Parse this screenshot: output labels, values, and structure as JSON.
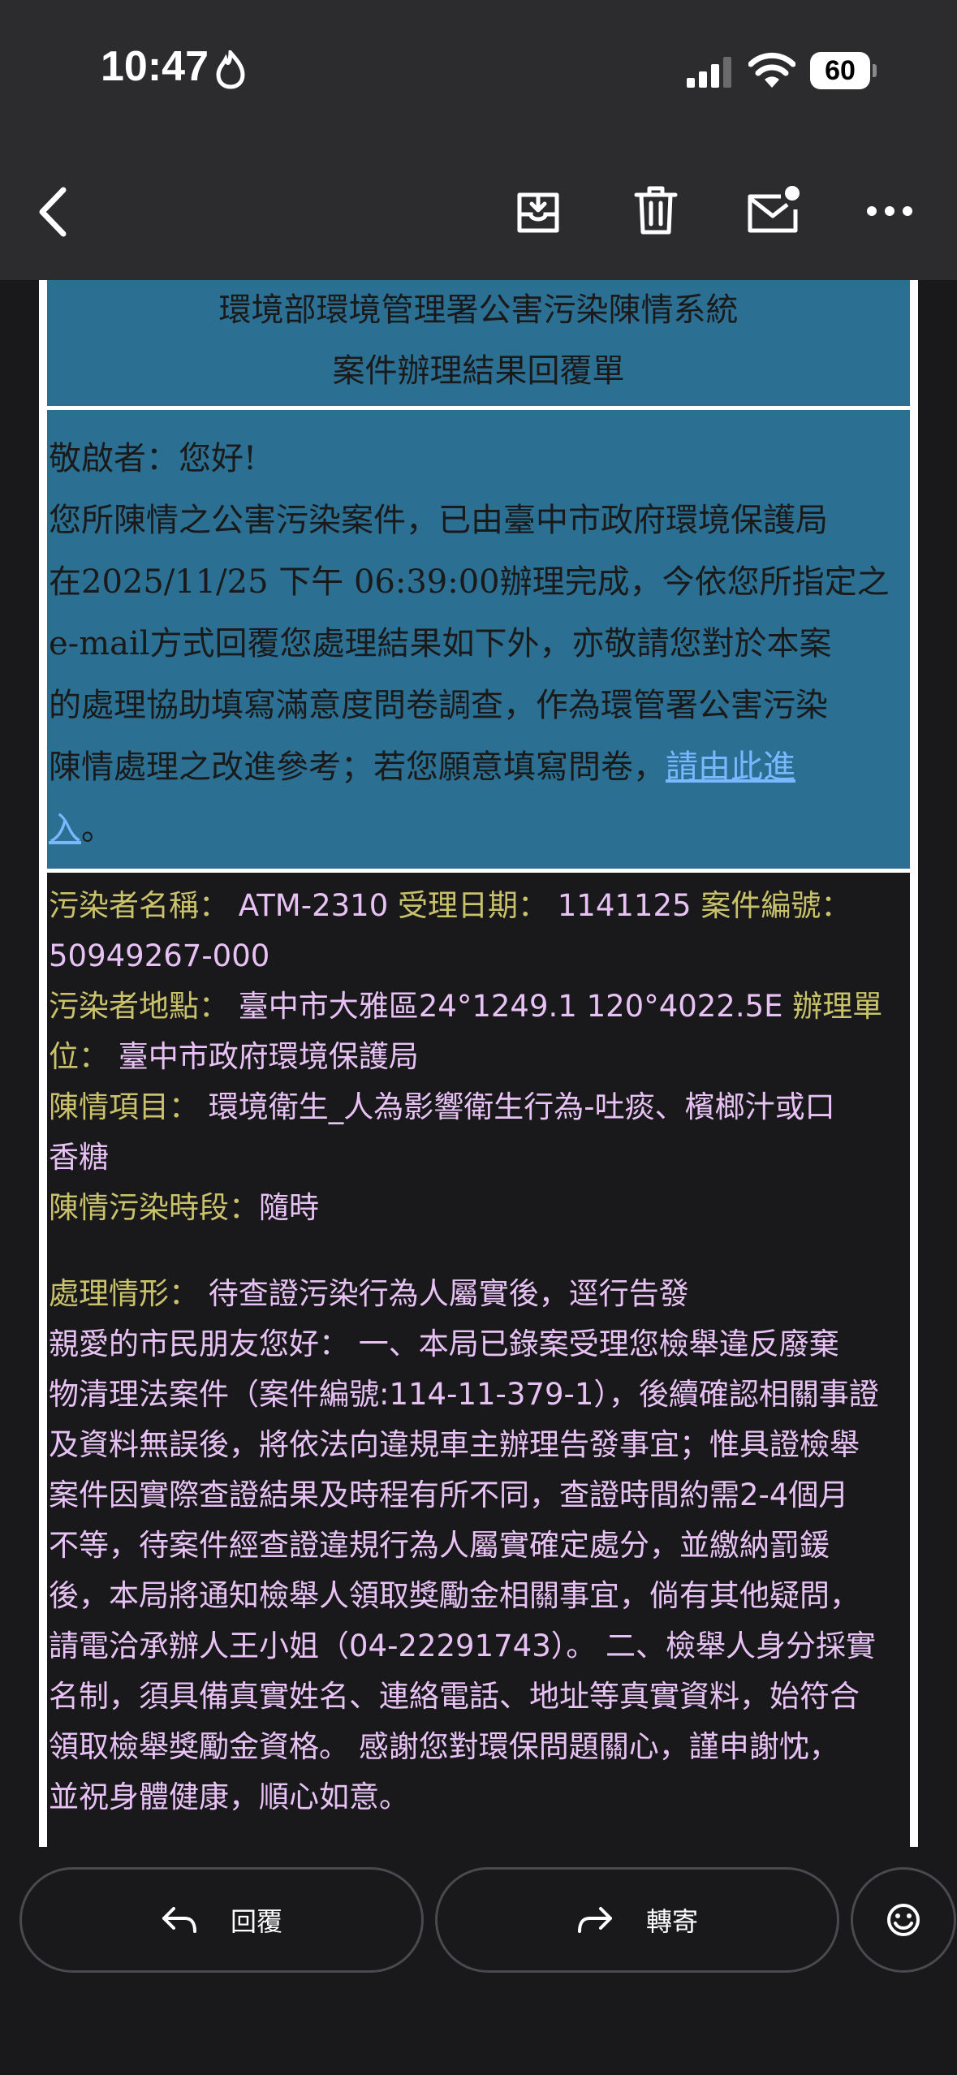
{
  "status_bar": {
    "time": "10:47",
    "battery_level": "60"
  },
  "toolbar": {
    "icons": [
      "back-chevron-icon",
      "archive-icon",
      "trash-icon",
      "mark-unread-icon",
      "more-icon"
    ]
  },
  "email": {
    "title_line1": "環境部環境管理署公害污染陳情系統",
    "title_line2": "案件辦理結果回覆單",
    "greeting": "敬啟者：您好!",
    "body_lines": [
      "您所陳情之公害污染案件，已由臺中市政府環境保護局",
      "在2025/11/25 下午 06:39:00辦理完成，今依您所指定之",
      "e-mail方式回覆您處理結果如下外，亦敬請您對於本案",
      "的處理協助填寫滿意度問卷調查，作為環管署公害污染"
    ],
    "body_last_prefix": "陳情處理之改進參考；若您願意填寫問卷，",
    "survey_link_part1": "請由此進",
    "survey_link_part2": "入",
    "body_end": "。",
    "info": {
      "polluter_name_label": "污染者名稱：",
      "polluter_name": " ATM-2310 ",
      "accept_date_label": "受理日期：",
      "accept_date": " 1141125 ",
      "case_no_label": "案件編號：",
      "case_no": "50949267-000",
      "location_label": "污染者地點：",
      "location": " 臺中市大雅區24°1249.1 120°4022.5E ",
      "unit_label_part1": "辦理單",
      "unit_label_part2": "位：",
      "unit": " 臺中市政府環境保護局",
      "item_label": "陳情項目：",
      "item_line1": " 環境衛生_人為影響衛生行為-吐痰、檳榔汁或口",
      "item_line2": "香糖",
      "period_label": "陳情污染時段：",
      "period": "隨時",
      "handling_label": "處理情形：",
      "handling_summary": " 待查證污染行為人屬實後，逕行告發",
      "handling_lines": [
        "親愛的市民朋友您好： 一、本局已錄案受理您檢舉違反廢棄",
        "物清理法案件（案件編號:114-11-379-1），後續確認相關事證",
        "及資料無誤後，將依法向違規車主辦理告發事宜；惟具證檢舉",
        "案件因實際查證結果及時程有所不同，查證時間約需2-4個月",
        "不等，待案件經查證違規行為人屬實確定處分，並繳納罰鍰",
        "後，本局將通知檢舉人領取獎勵金相關事宜，倘有其他疑問，",
        "請電洽承辦人王小姐（04-22291743）。 二、檢舉人身分採實",
        "名制，須具備真實姓名、連絡電話、地址等真實資料，始符合",
        "領取檢舉獎勵金資格。 感謝您對環保問題關心，謹申謝忱，",
        "並祝身體健康，順心如意。"
      ]
    }
  },
  "bottom_bar": {
    "reply_label": "回覆",
    "forward_label": "轉寄"
  }
}
